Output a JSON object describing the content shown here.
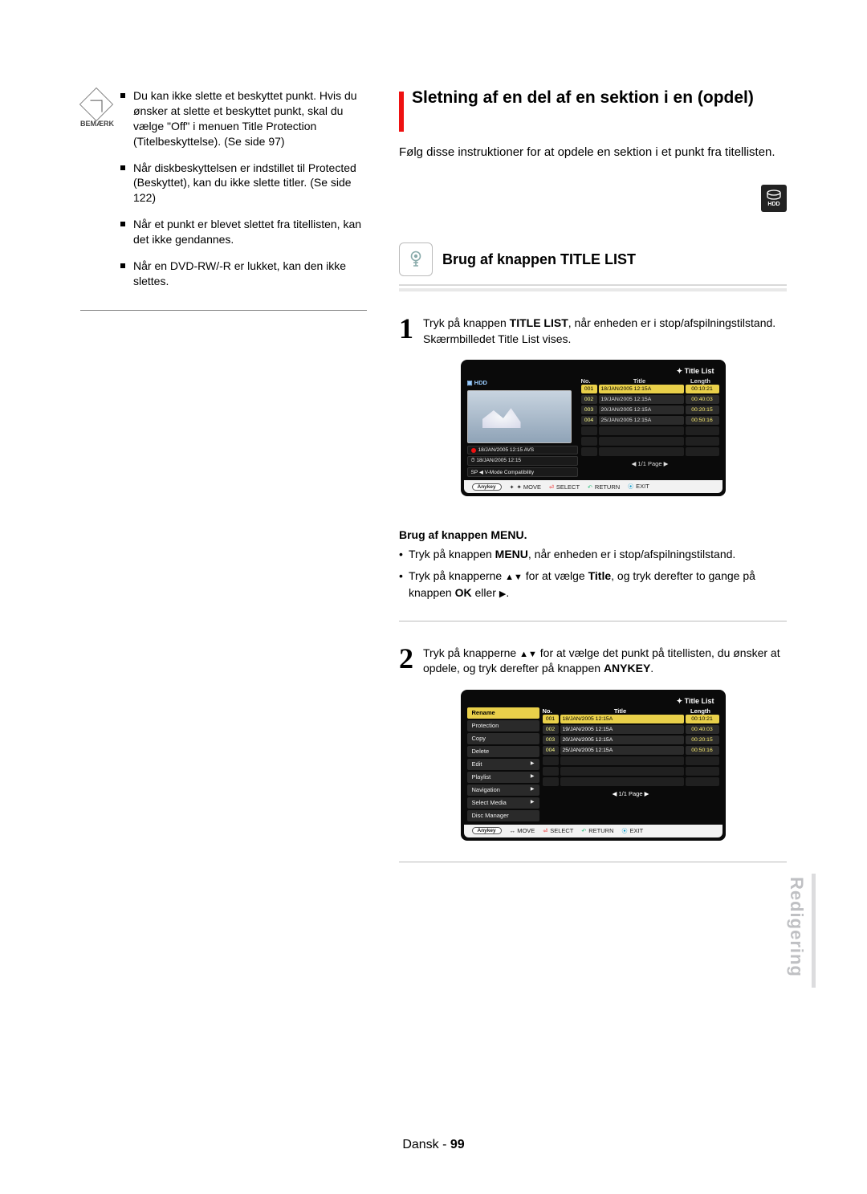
{
  "left": {
    "note_label": "BEMÆRK",
    "items": [
      "Du kan ikke slette et beskyttet punkt. Hvis du ønsker at slette et beskyttet punkt, skal du vælge \"Off\" i menuen Title Protection (Titelbeskyttelse). (Se side 97)",
      "Når diskbeskyttelsen er indstillet til Protected (Beskyttet), kan du ikke slette titler. (Se side 122)",
      "Når et punkt er blevet slettet fra titellisten, kan det ikke gendannes.",
      "Når en DVD-RW/-R er lukket, kan den ikke slettes."
    ]
  },
  "right": {
    "h2": "Sletning af en del af en sektion i en (opdel)",
    "intro": "Følg disse instruktioner for at opdele en sektion i et punkt fra titellisten.",
    "hdd_label": "HDD",
    "h3": "Brug af knappen TITLE LIST",
    "step1_a": "Tryk på knappen ",
    "step1_b": "TITLE LIST",
    "step1_c": ", når enheden er i stop/afspilningstilstand.",
    "step1_d": "Skærmbilledet Title List vises.",
    "menu_h4": "Brug af knappen MENU.",
    "menu_items_a": "Tryk på knappen ",
    "menu_items_b": "MENU",
    "menu_items_c": ", når enheden er i stop/afspilningstilstand.",
    "menu_item2_a": "Tryk på knapperne ",
    "menu_item2_b": " for at vælge ",
    "menu_item2_c": "Title",
    "menu_item2_d": ", og tryk derefter to gange på knappen ",
    "menu_item2_e": "OK",
    "menu_item2_f": " eller ",
    "step2_a": "Tryk på knapperne ",
    "step2_b": " for at vælge det punkt på titellisten, du ønsker at opdele, og tryk derefter på knappen ",
    "step2_c": "ANYKEY",
    "step2_d": "."
  },
  "osd": {
    "title": "Title List",
    "source": "HDD",
    "th_no": "No.",
    "th_title": "Title",
    "th_len": "Length",
    "rows": [
      {
        "no": "001",
        "title": "18/JAN/2005 12:15A",
        "len": "00:10:21"
      },
      {
        "no": "002",
        "title": "19/JAN/2005 12:15A",
        "len": "00:40:03"
      },
      {
        "no": "003",
        "title": "20/JAN/2005 12:15A",
        "len": "00:20:15"
      },
      {
        "no": "004",
        "title": "25/JAN/2005 12:15A",
        "len": "00:50:16"
      }
    ],
    "rec1": "18/JAN/2005 12:15 AVS",
    "rec2": "18/JAN/2005 12:15",
    "rec3": "SP ◀ V-Mode Compatibility",
    "pager": "1/1 Page",
    "anykey": "Anykey",
    "move": "MOVE",
    "select": "SELECT",
    "return": "RETURN",
    "exit": "EXIT",
    "menu": [
      "Rename",
      "Protection",
      "Copy",
      "Delete",
      "Edit",
      "Playlist",
      "Navigation",
      "Select Media",
      "Disc Manager"
    ]
  },
  "side_tab": "Redigering",
  "footer_a": "Dansk",
  "footer_b": " - ",
  "footer_c": "99"
}
